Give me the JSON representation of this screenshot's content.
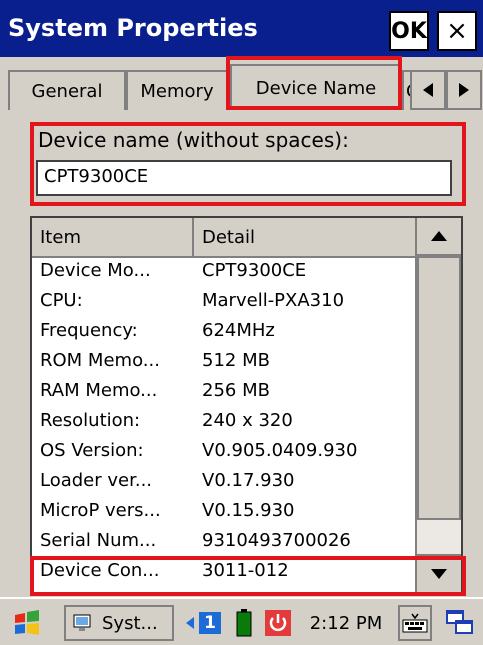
{
  "window": {
    "title": "System Properties",
    "ok_label": "OK",
    "close_label": "×"
  },
  "tabs": [
    {
      "label": "General"
    },
    {
      "label": "Memory"
    },
    {
      "label": "Device Name"
    },
    {
      "label": "C"
    }
  ],
  "device": {
    "label": "Device name (without spaces):",
    "value": "CPT9300CE"
  },
  "list": {
    "headers": [
      "Item",
      "Detail"
    ],
    "rows": [
      {
        "item": "Device Mo...",
        "detail": "CPT9300CE"
      },
      {
        "item": "CPU:",
        "detail": "Marvell-PXA310"
      },
      {
        "item": "Frequency:",
        "detail": "624MHz"
      },
      {
        "item": "ROM Memo...",
        "detail": "512 MB"
      },
      {
        "item": "RAM Memo...",
        "detail": "256 MB"
      },
      {
        "item": "Resolution:",
        "detail": "240 x 320"
      },
      {
        "item": "OS Version:",
        "detail": "V0.905.0409.930"
      },
      {
        "item": "Loader ver...",
        "detail": "V0.17.930"
      },
      {
        "item": "MicroP vers...",
        "detail": "V0.15.930"
      },
      {
        "item": "Serial Num...",
        "detail": "9310493700026"
      },
      {
        "item": "Device Con...",
        "detail": "3011-012"
      }
    ]
  },
  "taskbar": {
    "app_label": "Syst...",
    "page_number": "1",
    "time": "2:12 PM"
  },
  "colors": {
    "titlebar": "#0a1f8e",
    "highlight_box": "#e3151c",
    "face": "#d4d0c8"
  }
}
